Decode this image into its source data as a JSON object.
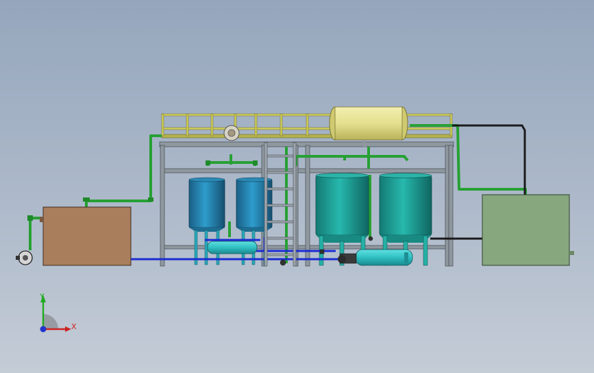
{
  "scene": {
    "colors": {
      "background_top": "#95a6bc",
      "frame_steel": "#8a929c",
      "railing_yellow": "#cfd05a",
      "pipe_green": "#2a9a35",
      "pipe_blue": "#1c2bd0",
      "pipe_black": "#1a1a1a",
      "tank_blue": "#1f7fa8",
      "tank_teal": "#1fa29a",
      "brown_tank": "#a97e5c",
      "green_tank": "#86a97e",
      "yellow_vessel": "#e4e08e"
    },
    "triad": {
      "x_label": "X",
      "y_label": "Y",
      "x_color": "#cc2222",
      "y_color": "#22aa22",
      "z_color": "#2233cc"
    }
  }
}
